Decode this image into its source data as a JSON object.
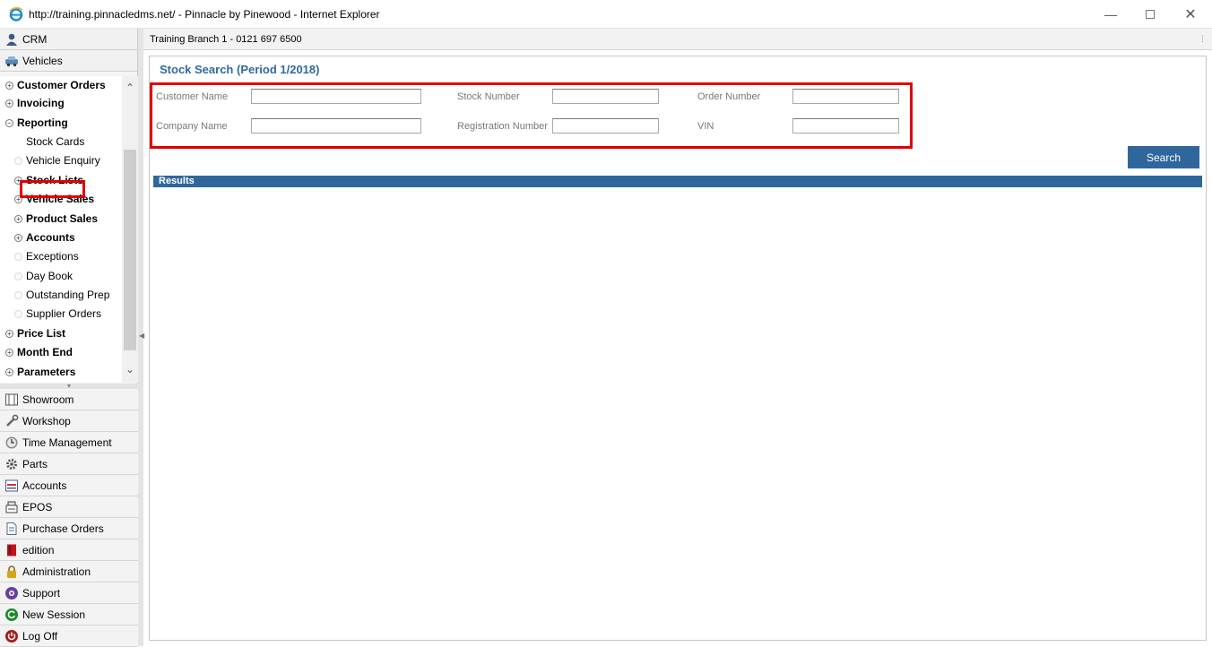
{
  "window": {
    "title": "http://training.pinnacledms.net/ - Pinnacle by Pinewood - Internet Explorer",
    "minimize_icon": "minimize-icon",
    "maximize_icon": "maximize-icon",
    "close_icon": "close-icon"
  },
  "nav": {
    "top_modules": [
      {
        "label": "CRM",
        "icon": "user-icon"
      },
      {
        "label": "Vehicles",
        "icon": "car-icon"
      }
    ],
    "tree": [
      {
        "label": "Customer Orders",
        "bold": true,
        "expander": "+"
      },
      {
        "label": "Invoicing",
        "bold": true,
        "expander": "+"
      },
      {
        "label": "Reporting",
        "bold": true,
        "expander": "-"
      },
      {
        "label": "Stock Cards",
        "bold": false,
        "selected": true
      },
      {
        "label": "Vehicle Enquiry",
        "bold": false
      },
      {
        "label": "Stock Lists",
        "bold": true,
        "expander": "+"
      },
      {
        "label": "Vehicle Sales",
        "bold": true,
        "expander": "+"
      },
      {
        "label": "Product Sales",
        "bold": true,
        "expander": "+"
      },
      {
        "label": "Accounts",
        "bold": true,
        "expander": "+"
      },
      {
        "label": "Exceptions",
        "bold": false
      },
      {
        "label": "Day Book",
        "bold": false
      },
      {
        "label": "Outstanding Prep",
        "bold": false
      },
      {
        "label": "Supplier Orders",
        "bold": false
      },
      {
        "label": "Price List",
        "bold": true,
        "expander": "+"
      },
      {
        "label": "Month End",
        "bold": true,
        "expander": "+"
      },
      {
        "label": "Parameters",
        "bold": true,
        "expander": "+"
      }
    ],
    "modules": [
      {
        "label": "Showroom",
        "icon": "showroom-icon"
      },
      {
        "label": "Workshop",
        "icon": "wrench-icon"
      },
      {
        "label": "Time Management",
        "icon": "clock-icon"
      },
      {
        "label": "Parts",
        "icon": "gear-icon"
      },
      {
        "label": "Accounts",
        "icon": "ledger-icon"
      },
      {
        "label": "EPOS",
        "icon": "till-icon"
      },
      {
        "label": "Purchase Orders",
        "icon": "document-icon"
      },
      {
        "label": "edition",
        "icon": "book-icon"
      },
      {
        "label": "Administration",
        "icon": "lock-icon"
      },
      {
        "label": "Support",
        "icon": "support-icon"
      },
      {
        "label": "New Session",
        "icon": "refresh-icon"
      },
      {
        "label": "Log Off",
        "icon": "power-icon"
      }
    ]
  },
  "branch": "Training Branch 1 - 0121 697 6500",
  "page": {
    "title": "Stock Search (Period 1/2018)",
    "fields": {
      "customer_name": {
        "label": "Customer Name",
        "value": ""
      },
      "stock_number": {
        "label": "Stock Number",
        "value": ""
      },
      "order_number": {
        "label": "Order Number",
        "value": ""
      },
      "company_name": {
        "label": "Company Name",
        "value": ""
      },
      "registration_number": {
        "label": "Registration Number",
        "value": ""
      },
      "vin": {
        "label": "VIN",
        "value": ""
      }
    },
    "search_label": "Search",
    "results_label": "Results"
  },
  "colors": {
    "accent": "#2f679d",
    "highlight": "#e00000",
    "title": "#2e6aa1"
  }
}
